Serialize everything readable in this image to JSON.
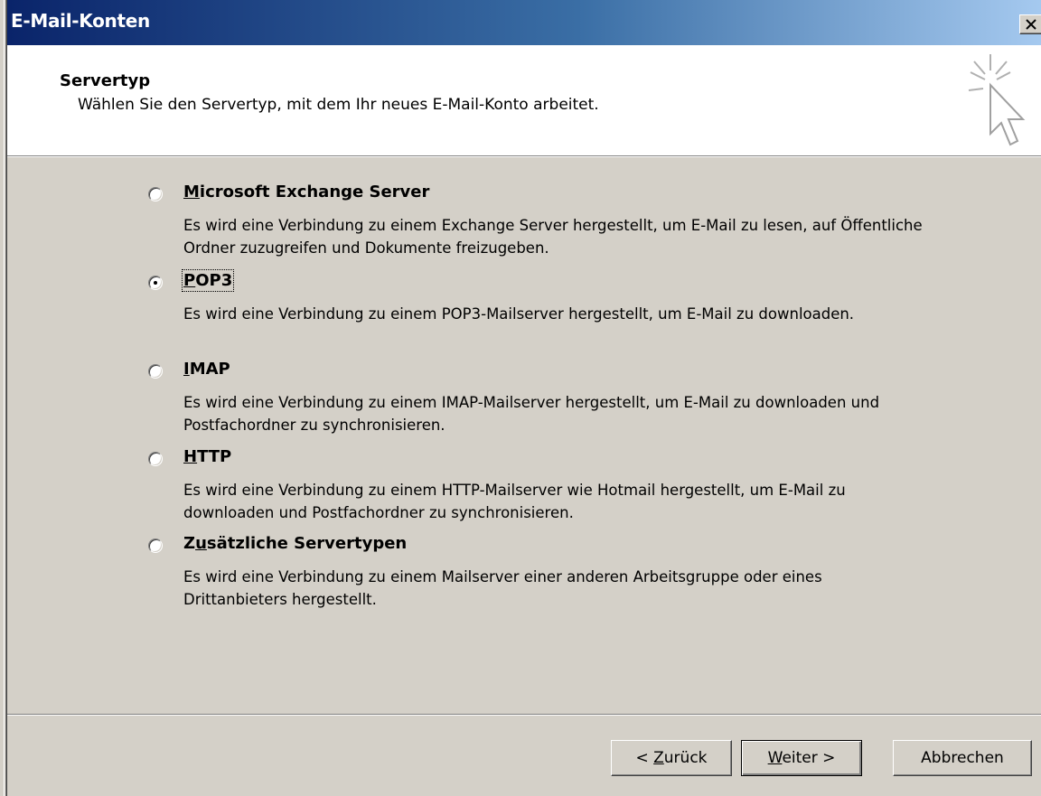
{
  "window": {
    "title": "E-Mail-Konten"
  },
  "header": {
    "title": "Servertyp",
    "subtitle": "Wählen Sie den Servertyp, mit dem Ihr neues E-Mail-Konto arbeitet."
  },
  "options": [
    {
      "label_prefix": "",
      "label_mnemonic": "M",
      "label_rest": "icrosoft Exchange Server",
      "description": "Es wird eine Verbindung zu einem Exchange Server hergestellt, um E-Mail zu lesen, auf Öffentliche Ordner zuzugreifen und Dokumente freizugeben.",
      "selected": false
    },
    {
      "label_prefix": "",
      "label_mnemonic": "P",
      "label_rest": "OP3",
      "description": "Es wird eine Verbindung zu einem POP3-Mailserver hergestellt, um E-Mail zu downloaden.",
      "selected": true
    },
    {
      "label_prefix": "",
      "label_mnemonic": "I",
      "label_rest": "MAP",
      "description": "Es wird eine Verbindung zu einem IMAP-Mailserver hergestellt, um E-Mail zu downloaden und Postfachordner zu synchronisieren.",
      "selected": false
    },
    {
      "label_prefix": "",
      "label_mnemonic": "H",
      "label_rest": "TTP",
      "description": "Es wird eine Verbindung zu einem HTTP-Mailserver wie Hotmail hergestellt, um E-Mail zu downloaden und Postfachordner zu synchronisieren.",
      "selected": false
    },
    {
      "label_prefix": "Z",
      "label_mnemonic": "u",
      "label_rest": "sätzliche Servertypen",
      "description": "Es wird eine Verbindung zu einem Mailserver einer anderen Arbeitsgruppe oder eines Drittanbieters hergestellt.",
      "selected": false
    }
  ],
  "buttons": {
    "back_prefix": "< ",
    "back_mnemonic": "Z",
    "back_rest": "urück",
    "next_mnemonic": "W",
    "next_rest": "eiter >",
    "cancel": "Abbrechen"
  },
  "icons": {
    "close": "close-icon",
    "wizard": "cursor-sparkle-icon"
  },
  "colors": {
    "titlebar_start": "#0a246a",
    "titlebar_end": "#a6caf0",
    "dialog_face": "#d4d0c8"
  }
}
